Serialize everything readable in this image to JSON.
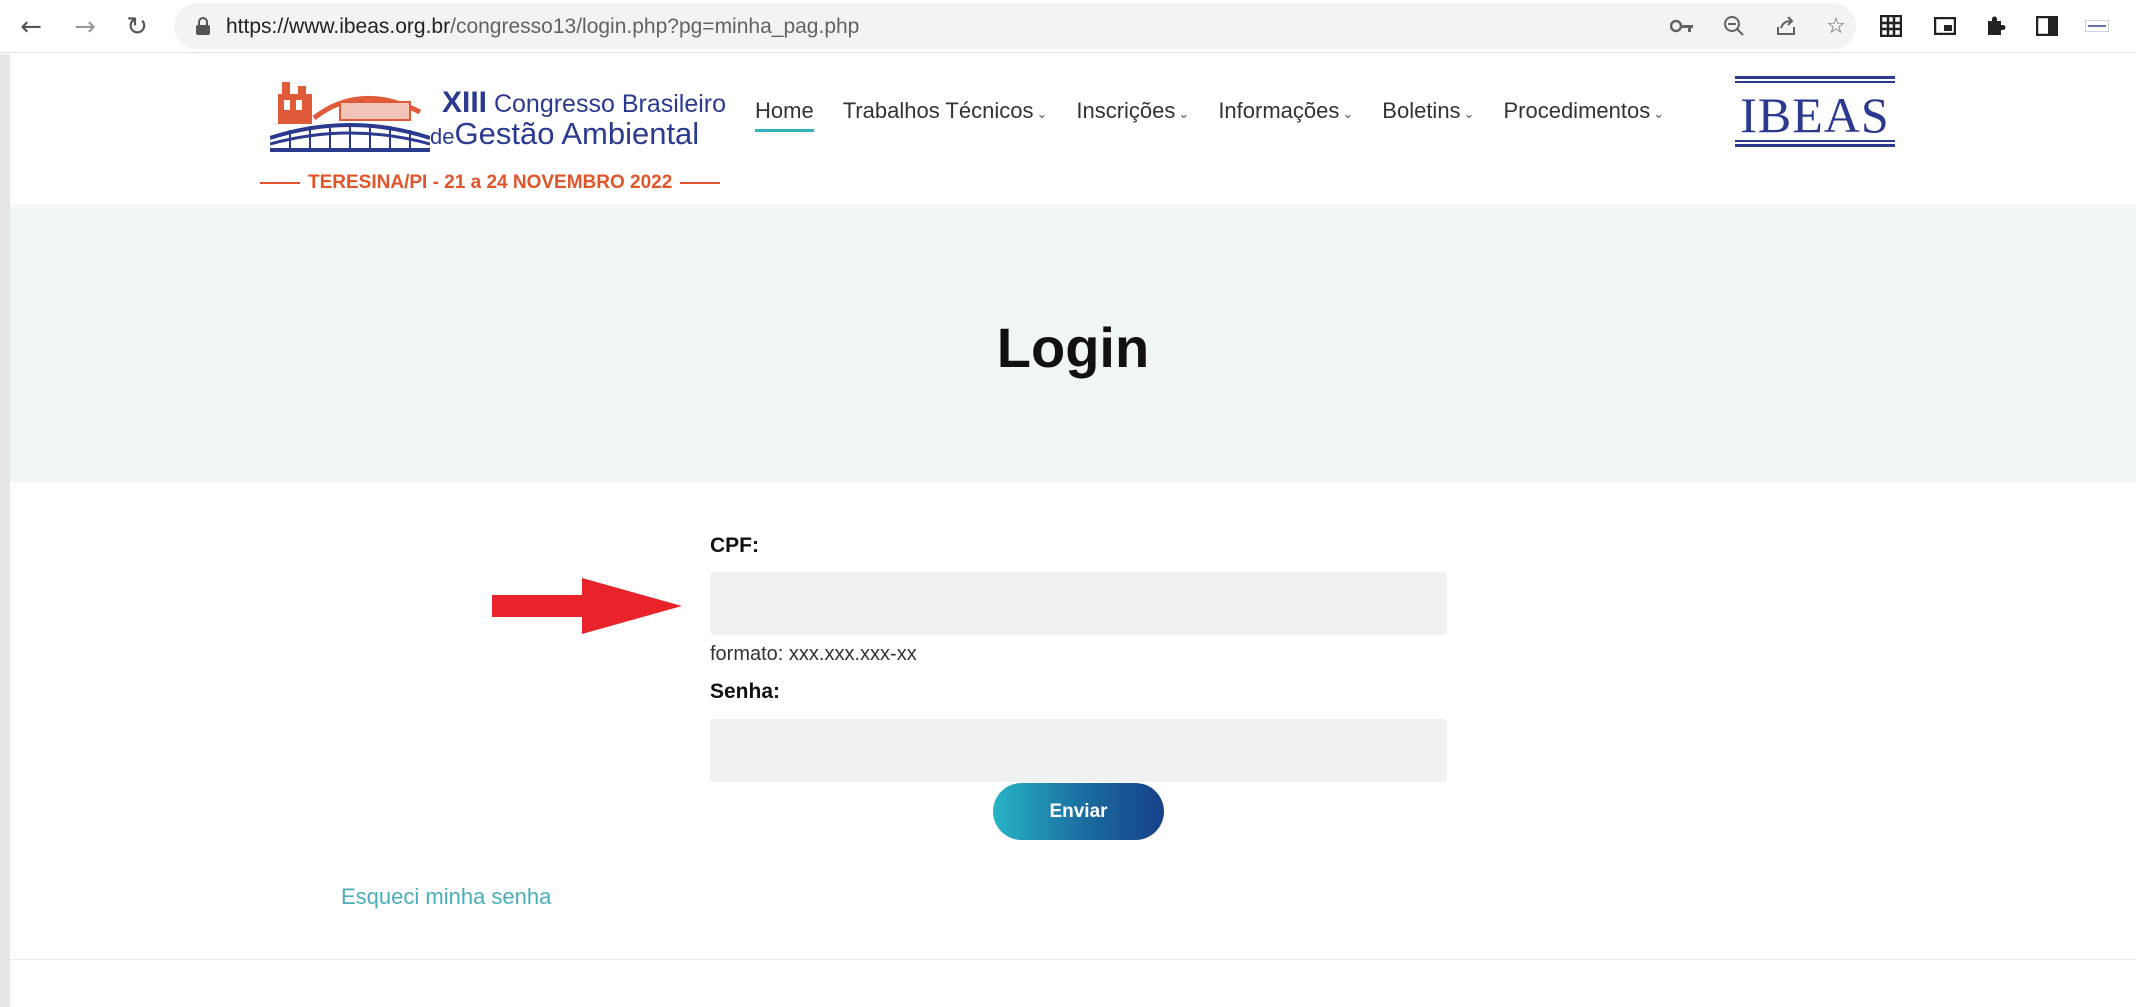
{
  "browser": {
    "url_host": "https://www.ibeas.org.br",
    "url_path": "/congresso13/login.php?pg=minha_pag.php"
  },
  "logo": {
    "numeral": "XIII",
    "line1": "Congresso Brasileiro",
    "line2_prefix": "de",
    "line2": "Gestão Ambiental",
    "tagline": "TERESINA/PI - 21 a 24 NOVEMBRO 2022"
  },
  "nav": {
    "items": [
      {
        "label": "Home",
        "active": true,
        "dropdown": false
      },
      {
        "label": "Trabalhos Técnicos",
        "dropdown": true
      },
      {
        "label": "Inscrições",
        "dropdown": true
      },
      {
        "label": "Informações",
        "dropdown": true
      },
      {
        "label": "Boletins",
        "dropdown": true
      },
      {
        "label": "Procedimentos",
        "dropdown": true
      }
    ]
  },
  "partner_logo": "IBEAS",
  "hero": {
    "title": "Login"
  },
  "form": {
    "cpf_label": "CPF:",
    "cpf_value": "",
    "cpf_hint": "formato: xxx.xxx.xxx-xx",
    "password_label": "Senha:",
    "password_value": "",
    "submit_label": "Enviar",
    "forgot_label": "Esqueci minha senha"
  },
  "colors": {
    "accent": "#2fb3bf",
    "brand_blue": "#2b3a8f",
    "arrow": "#e8232a",
    "hero_bg": "#f0f5f6"
  }
}
